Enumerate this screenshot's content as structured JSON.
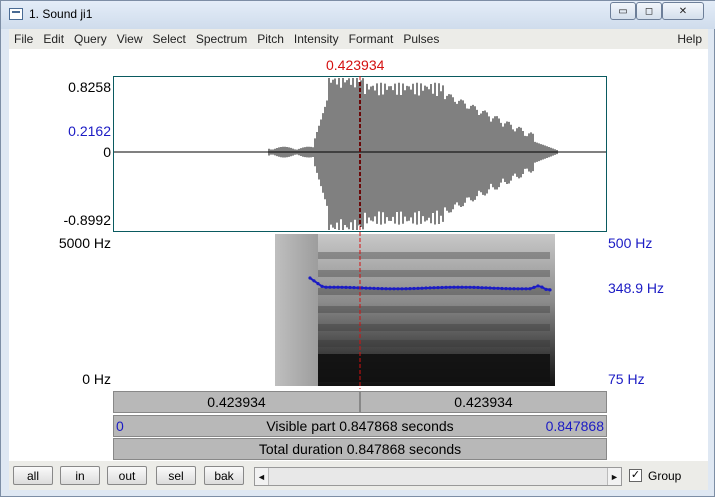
{
  "window": {
    "title": "1. Sound ji1",
    "controls": {
      "minimize": "▭",
      "maximize": "◻",
      "close": "✕"
    }
  },
  "menu": {
    "items": [
      "File",
      "Edit",
      "Query",
      "View",
      "Select",
      "Spectrum",
      "Pitch",
      "Intensity",
      "Formant",
      "Pulses"
    ],
    "help": "Help"
  },
  "cursor": {
    "time": "0.423934",
    "color": "#d41010"
  },
  "waveform": {
    "max_label": "0.8258",
    "cursor_value_label": "0.2162",
    "zero_label": "0",
    "min_label": "-0.8992"
  },
  "spectrogram": {
    "freq_top_label": "5000 Hz",
    "freq_bottom_label": "0 Hz",
    "pitch_top_label": "500 Hz",
    "pitch_value_label": "348.9 Hz",
    "pitch_bottom_label": "75 Hz",
    "pitch_color": "#1b1bc4"
  },
  "time_bars": {
    "left_segment": "0.423934",
    "right_segment": "0.423934",
    "visible_start": "0",
    "visible_text": "Visible part 0.847868 seconds",
    "visible_end": "0.847868",
    "total_text": "Total duration 0.847868 seconds"
  },
  "bottom": {
    "buttons": [
      "all",
      "in",
      "out",
      "sel",
      "bak"
    ],
    "scroll_left_icon": "◄",
    "scroll_right_icon": "►",
    "group_checked": "✓",
    "group_label": "Group"
  }
}
